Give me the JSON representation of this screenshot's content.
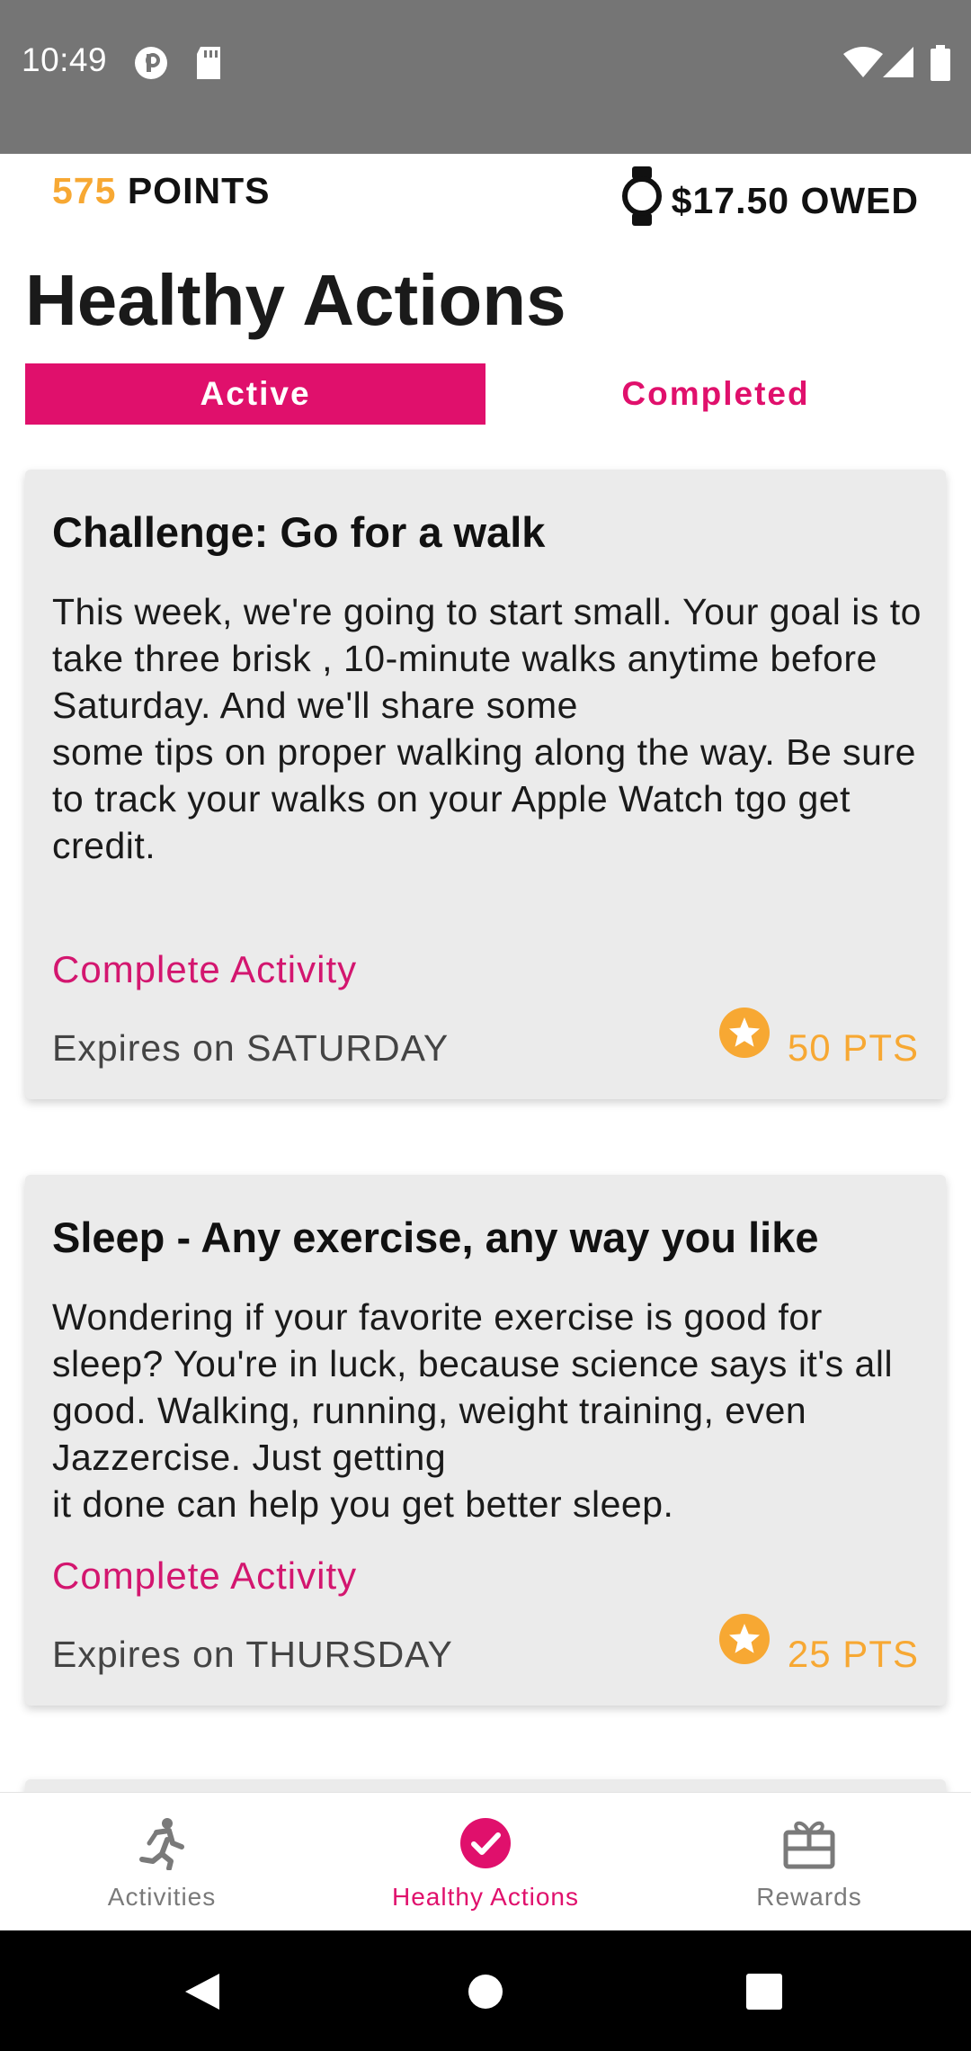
{
  "status_bar": {
    "time": "10:49"
  },
  "header": {
    "points_value": "575",
    "points_label": "POINTS",
    "owed": "$17.50 OWED"
  },
  "page": {
    "title": "Healthy Actions"
  },
  "tabs": [
    {
      "label": "Active",
      "selected": true
    },
    {
      "label": "Completed",
      "selected": false
    }
  ],
  "cards": [
    {
      "title": "Challenge: Go for a walk",
      "body": "This week, we're going to start small. Your goal is to take three brisk , 10-minute walks anytime before Saturday. And we'll share some\nsome tips on proper walking along the way. Be sure to track your walks on your Apple Watch tgo get credit.",
      "cta": "Complete Activity",
      "expires": "Expires on SATURDAY",
      "points": "50 PTS"
    },
    {
      "title": "Sleep - Any exercise, any way you like",
      "body": "Wondering if your favorite exercise is good for sleep? You're in luck, because science says it's all good. Walking, running, weight training, even Jazzercise. Just getting\nit done can help you get better sleep.",
      "cta": "Complete Activity",
      "expires": "Expires on THURSDAY",
      "points": "25 PTS"
    }
  ],
  "bottom_nav": [
    {
      "label": "Activities",
      "icon": "runner-icon",
      "selected": false
    },
    {
      "label": "Healthy Actions",
      "icon": "check-circle-icon",
      "selected": true
    },
    {
      "label": "Rewards",
      "icon": "gift-icon",
      "selected": false
    }
  ],
  "colors": {
    "accent": "#e0106c",
    "points": "#f7a833",
    "status_bar": "#757575"
  }
}
